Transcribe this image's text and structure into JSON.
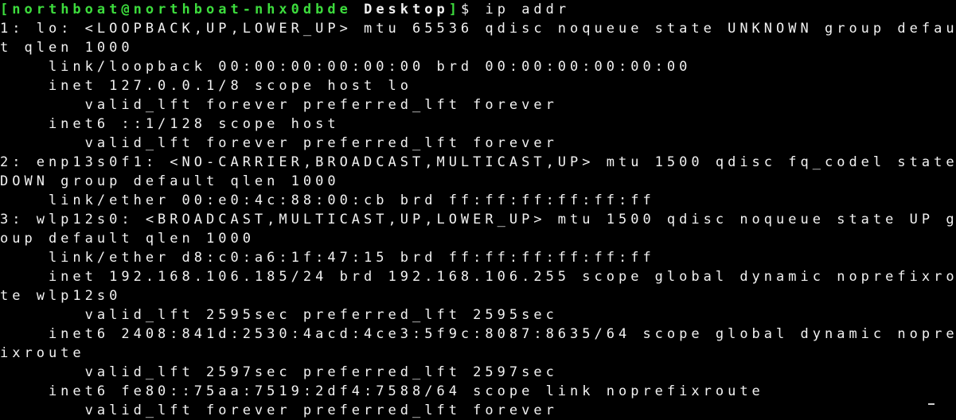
{
  "prompt": {
    "open_bracket": "[",
    "user_host": "northboat@northboat-nhx0dbde",
    "cwd": "Desktop",
    "close_bracket": "]",
    "symbol": "$",
    "command": "ip addr"
  },
  "output_lines": [
    "1: lo: <LOOPBACK,UP,LOWER_UP> mtu 65536 qdisc noqueue state UNKNOWN group defaul",
    "t qlen 1000",
    "    link/loopback 00:00:00:00:00:00 brd 00:00:00:00:00:00",
    "    inet 127.0.0.1/8 scope host lo",
    "       valid_lft forever preferred_lft forever",
    "    inet6 ::1/128 scope host",
    "       valid_lft forever preferred_lft forever",
    "2: enp13s0f1: <NO-CARRIER,BROADCAST,MULTICAST,UP> mtu 1500 qdisc fq_codel state",
    "DOWN group default qlen 1000",
    "    link/ether 00:e0:4c:88:00:cb brd ff:ff:ff:ff:ff:ff",
    "3: wlp12s0: <BROADCAST,MULTICAST,UP,LOWER_UP> mtu 1500 qdisc noqueue state UP gr",
    "oup default qlen 1000",
    "    link/ether d8:c0:a6:1f:47:15 brd ff:ff:ff:ff:ff:ff",
    "    inet 192.168.106.185/24 brd 192.168.106.255 scope global dynamic noprefixrou",
    "te wlp12s0",
    "       valid_lft 2595sec preferred_lft 2595sec",
    "    inet6 2408:841d:2530:4acd:4ce3:5f9c:8087:8635/64 scope global dynamic nopref",
    "ixroute",
    "       valid_lft 2597sec preferred_lft 2597sec",
    "    inet6 fe80::75aa:7519:2df4:7588/64 scope link noprefixroute",
    "       valid_lft forever preferred_lft forever"
  ],
  "colors": {
    "background": "#000000",
    "foreground": "#f2f2f2",
    "prompt_user": "#3ddc3d"
  }
}
